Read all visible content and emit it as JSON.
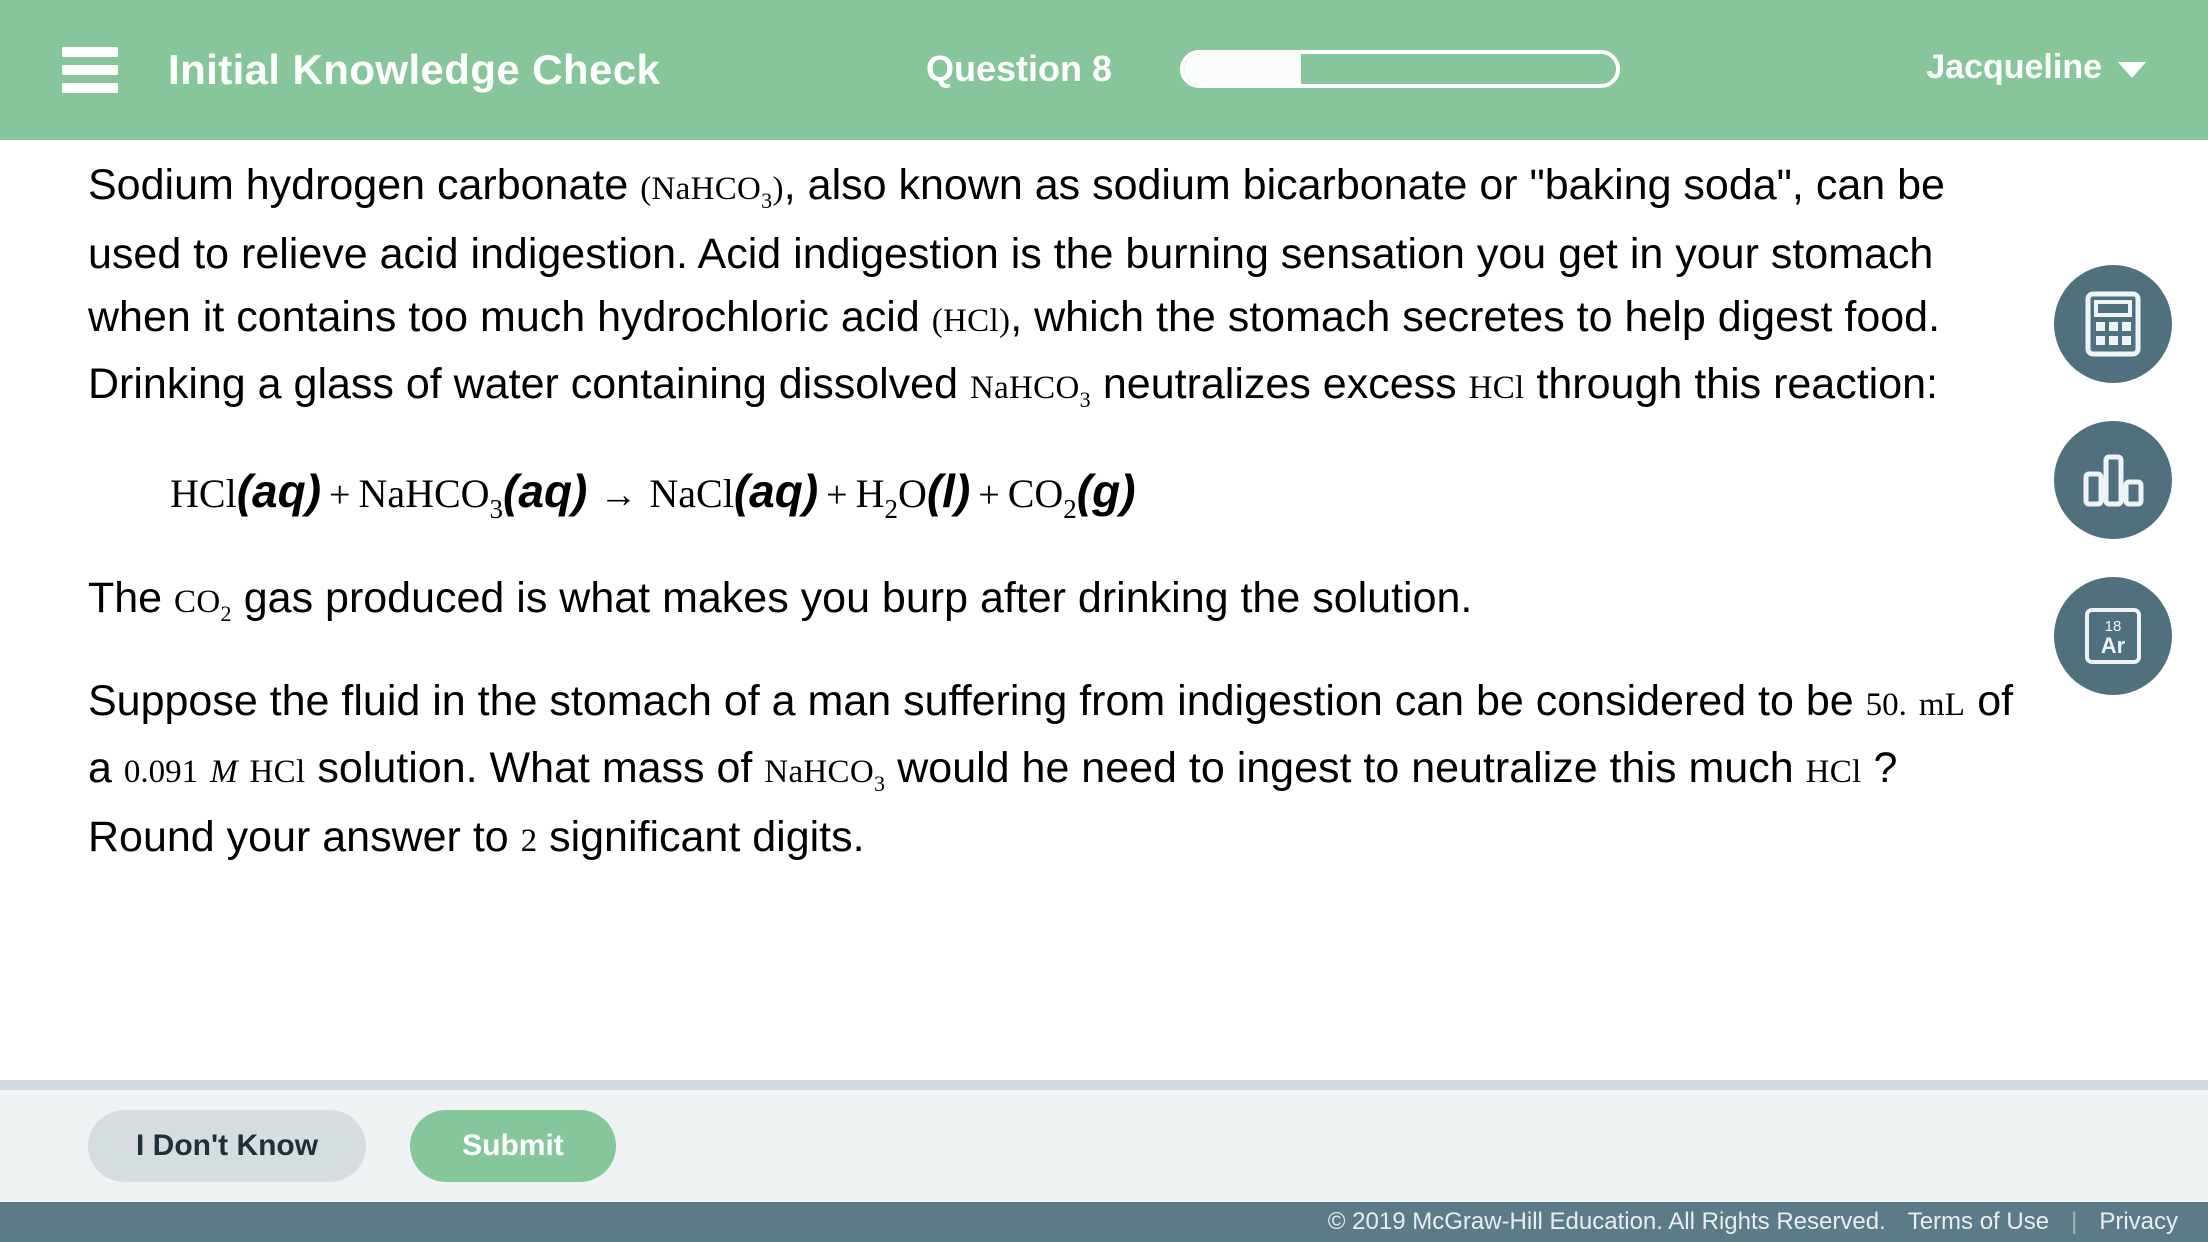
{
  "header": {
    "menu_icon": "hamburger-menu-icon",
    "title": "Initial Knowledge Check",
    "question_label": "Question 8",
    "progress_percent": 27,
    "user_name": "Jacqueline",
    "caret_icon": "chevron-down-icon",
    "bg_color": "#86c69a"
  },
  "question": {
    "p1": {
      "a": "Sodium hydrogen carbonate ",
      "f1_open": "(",
      "f1": "NaHCO",
      "f1_sub": "3",
      "f1_close": ")",
      "b": ", also known as sodium bicarbonate or \"baking soda\", can be used to relieve acid indigestion. Acid indigestion is the burning sensation you get in your stomach when it contains too much hydrochloric acid ",
      "f2_open": "(",
      "f2": "HCl",
      "f2_close": ")",
      "c": ", which the stomach secretes to help digest food. Drinking a glass of water containing dissolved ",
      "f3": "NaHCO",
      "f3_sub": "3",
      "d": " neutralizes excess ",
      "f4": "HCl",
      "e": " through this reaction:"
    },
    "equation": {
      "r1_formula": "HCl",
      "r1_state": "(aq)",
      "plus1": "+",
      "r2_formula": "NaHCO",
      "r2_sub": "3",
      "r2_state": "(aq)",
      "arrow": "→",
      "p1_formula": "NaCl",
      "p1_state": "(aq)",
      "plus2": "+",
      "p2_formula": "H",
      "p2_sub": "2",
      "p2_formula_b": "O",
      "p2_state": "(l)",
      "plus3": "+",
      "p3_formula": "CO",
      "p3_sub": "2",
      "p3_state": "(g)"
    },
    "p2": {
      "a": "The ",
      "f1": "CO",
      "f1_sub": "2",
      "b": " gas produced is what makes you burp after drinking the solution."
    },
    "p3": {
      "a": "Suppose the fluid in the stomach of a man suffering from indigestion can be considered to be ",
      "v1": "50.",
      "u1": "mL",
      "b": " of a ",
      "v2": "0.091",
      "u2": "M",
      "f1": "HCl",
      "c": " solution. What mass of ",
      "f2": "NaHCO",
      "f2_sub": "3",
      "d": " would he need to ingest to neutralize this much ",
      "f3": "HCl",
      "e": "? Round your answer to ",
      "v3": "2",
      "f": " significant digits."
    }
  },
  "tools": [
    {
      "name": "calculator-tool-button",
      "icon": "calculator-icon"
    },
    {
      "name": "data-chart-tool-button",
      "icon": "bar-chart-icon"
    },
    {
      "name": "periodic-table-tool-button",
      "icon": "periodic-table-icon",
      "element_number": "18",
      "element_symbol": "Ar"
    }
  ],
  "actions": {
    "dont_know_label": "I Don't Know",
    "submit_label": "Submit",
    "submit_color": "#85c79b",
    "dont_know_color": "#d6dde1"
  },
  "footer": {
    "copyright": "© 2019 McGraw-Hill Education. All Rights Reserved.",
    "terms_label": "Terms of Use",
    "divider": "|",
    "privacy_label": "Privacy",
    "bg_color": "#5b7b86"
  }
}
